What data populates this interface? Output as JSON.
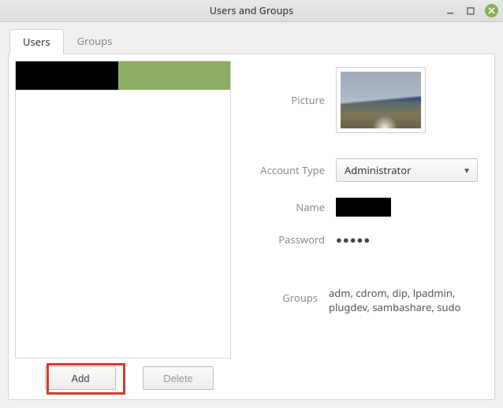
{
  "window": {
    "title": "Users and Groups"
  },
  "tabs": {
    "users": "Users",
    "groups": "Groups"
  },
  "buttons": {
    "add": "Add",
    "delete": "Delete"
  },
  "detail": {
    "labels": {
      "picture": "Picture",
      "account_type": "Account Type",
      "name": "Name",
      "password": "Password",
      "groups": "Groups"
    },
    "values": {
      "account_type": "Administrator",
      "password": "●●●●●",
      "groups": "adm, cdrom, dip, lpadmin, plugdev, sambashare, sudo"
    }
  }
}
